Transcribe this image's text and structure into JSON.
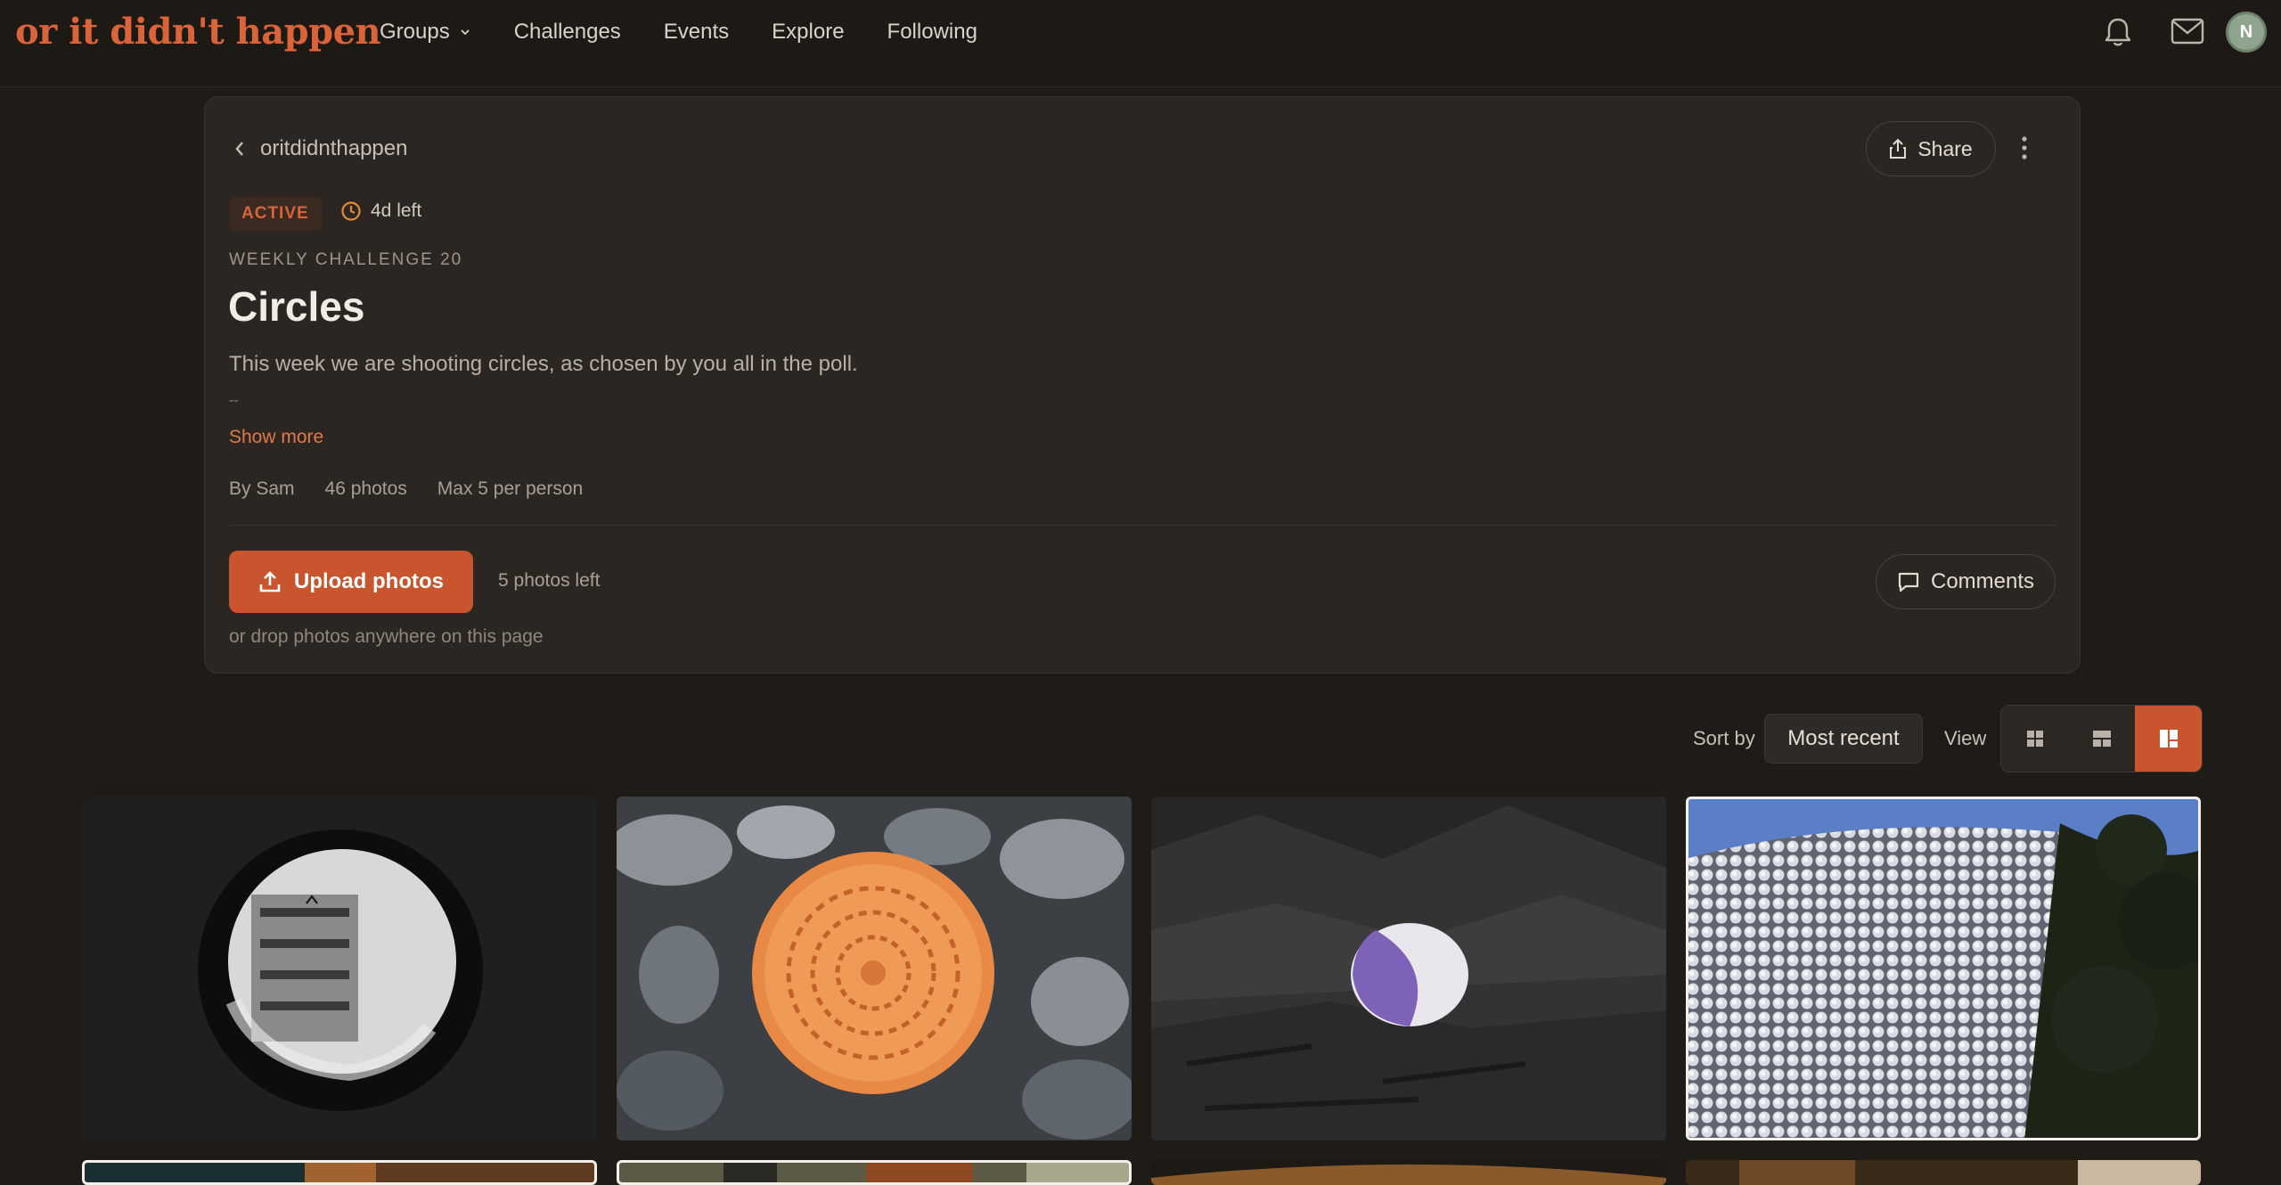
{
  "nav": {
    "logo": "or it didn't happen",
    "links": [
      "Groups",
      "Challenges",
      "Events",
      "Explore",
      "Following"
    ],
    "avatar_initial": "N",
    "icons": [
      "bell-icon",
      "mail-icon"
    ]
  },
  "challenge": {
    "back_label": "oritdidnthappen",
    "share_label": "Share",
    "status_badge": "ACTIVE",
    "time_left": "4d left",
    "kicker": "WEEKLY CHALLENGE 20",
    "title": "Circles",
    "description": "This week we are shooting circles, as chosen by you all in the poll.",
    "description_more": "--",
    "show_more": "Show more",
    "meta": {
      "author": "By Sam",
      "photos": "46 photos",
      "max": "Max 5 per person"
    },
    "upload_label": "Upload photos",
    "photos_left": "5 photos left",
    "drop_hint": "or drop photos anywhere on this page",
    "comments_label": "Comments"
  },
  "toolbar": {
    "sort_label": "Sort by",
    "sort_value": "Most recent",
    "view_label": "View",
    "view_options": [
      "grid-view",
      "row-view",
      "masonry-view"
    ],
    "active_view": "masonry-view"
  },
  "colors": {
    "accent": "#c8552e",
    "logo": "#d9643a",
    "background": "#1f1b17",
    "card": "#2b2621"
  }
}
